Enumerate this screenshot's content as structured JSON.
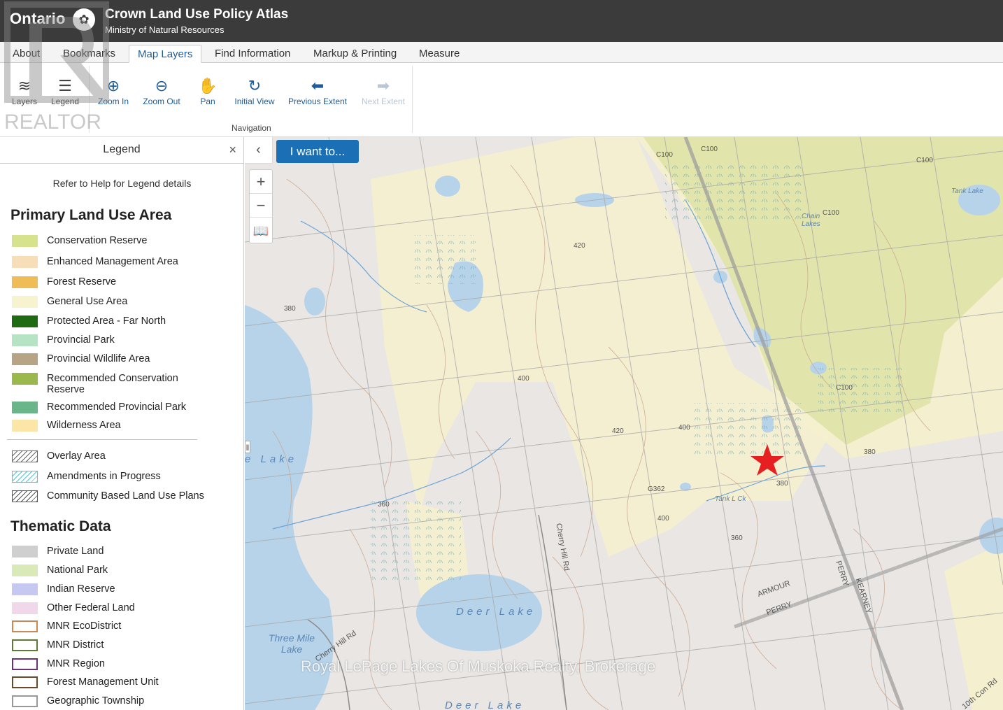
{
  "header": {
    "logo": "Ontario",
    "title": "Crown Land Use Policy Atlas",
    "subtitle": "Ministry of Natural Resources"
  },
  "tabs": [
    {
      "label": "About"
    },
    {
      "label": "Bookmarks"
    },
    {
      "label": "Map Layers",
      "active": true
    },
    {
      "label": "Find Information"
    },
    {
      "label": "Markup & Printing"
    },
    {
      "label": "Measure"
    }
  ],
  "ribbon": {
    "layers": "Layers",
    "legend": "Legend",
    "zoom_in": "Zoom In",
    "zoom_out": "Zoom Out",
    "pan": "Pan",
    "initial_view": "Initial View",
    "previous_extent": "Previous Extent",
    "next_extent": "Next Extent",
    "group_navigation": "Navigation"
  },
  "watermark": {
    "brand": "REALTOR",
    "brokerage": "Royal LePage Lakes Of Muskoka Realty, Brokerage"
  },
  "legend": {
    "title": "Legend",
    "close": "×",
    "note": "Refer to Help for Legend details",
    "primary_heading": "Primary Land Use Area",
    "primary_items": [
      {
        "label": "Conservation Reserve",
        "color": "#d7e28d"
      },
      {
        "label": "Enhanced Management Area",
        "color": "#f7ddb8"
      },
      {
        "label": "Forest Reserve",
        "color": "#eebd58"
      },
      {
        "label": "General Use Area",
        "color": "#f7f3cf"
      },
      {
        "label": "Protected Area - Far North",
        "color": "#1f6b12"
      },
      {
        "label": "Provincial Park",
        "color": "#b6e3c4"
      },
      {
        "label": "Provincial Wildlife Area",
        "color": "#b7a484"
      },
      {
        "label": "Recommended Conservation Reserve",
        "color": "#9ab84b"
      },
      {
        "label": "Recommended Provincial Park",
        "color": "#6bb58a"
      },
      {
        "label": "Wilderness Area",
        "color": "#fbe6a8"
      }
    ],
    "overlay_items": [
      {
        "label": "Overlay Area",
        "color": "#666666"
      },
      {
        "label": "Amendments in Progress",
        "color": "#48cbd6"
      },
      {
        "label": "Community Based Land Use Plans",
        "color": "#555555"
      }
    ],
    "thematic_heading": "Thematic Data",
    "thematic_items": [
      {
        "label": "Private Land",
        "color": "#cfcfcf",
        "style": "fill"
      },
      {
        "label": "National Park",
        "color": "#d9eab8",
        "style": "fill"
      },
      {
        "label": "Indian Reserve",
        "color": "#c6c8f2",
        "style": "fill"
      },
      {
        "label": "Other Federal Land",
        "color": "#f0d8ea",
        "style": "fill"
      },
      {
        "label": "MNR EcoDistrict",
        "color": "#c88a55",
        "style": "outline"
      },
      {
        "label": "MNR District",
        "color": "#5e7a35",
        "style": "outline"
      },
      {
        "label": "MNR Region",
        "color": "#6b3277",
        "style": "outline"
      },
      {
        "label": "Forest Management Unit",
        "color": "#6b4a2a",
        "style": "outline"
      },
      {
        "label": "Geographic Township",
        "color": "#999999",
        "style": "outline"
      }
    ]
  },
  "map": {
    "i_want_to": "I want to...",
    "labels": {
      "c100_a": "C100",
      "c100_b": "C100",
      "c100_c": "C100",
      "c100_d": "C100",
      "c100_e": "C100",
      "tank_lake": "Tank Lake",
      "chain_lakes": "Chain Lakes",
      "tank_l_ck": "Tank L Ck",
      "g362": "G362",
      "deer_lake": "Deer Lake",
      "deer_lake_bottom": "Deer Lake",
      "three_mile_lake": "Three Mile Lake",
      "lake_left": "e Lake",
      "cherry_hill_rd": "Cherry Hill Rd",
      "cherry_hill_rd2": "Cherry Hill Rd",
      "armour": "ARMOUR",
      "perry": "PERRY",
      "perry_v": "PERRY",
      "kearney": "KEARNEY",
      "con_rd": "10th Con Rd"
    },
    "contours": [
      "400",
      "420",
      "380",
      "360",
      "400",
      "380",
      "420",
      "360",
      "380",
      "400"
    ]
  }
}
